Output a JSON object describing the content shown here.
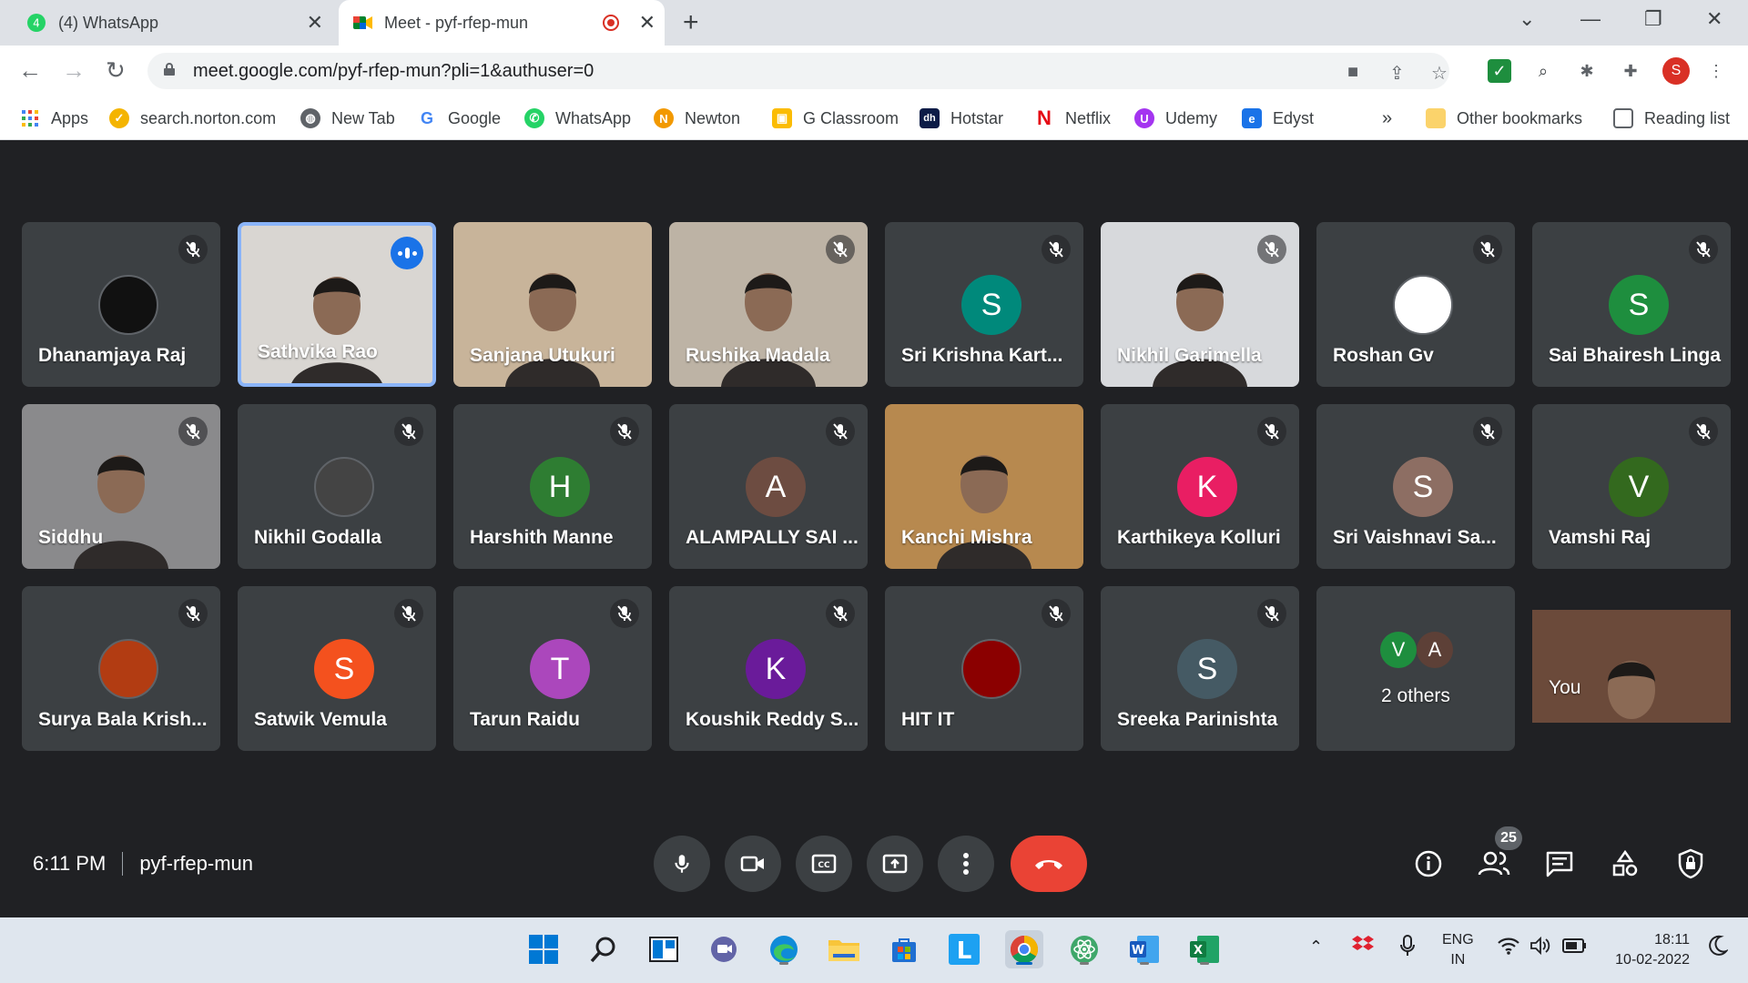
{
  "browser": {
    "tabs": [
      {
        "title": "(4) WhatsApp",
        "active": false
      },
      {
        "title": "Meet - pyf-rfep-mun",
        "active": true,
        "recording": true
      }
    ],
    "url": "meet.google.com/pyf-rfep-mun?pli=1&authuser=0",
    "profile_initial": "S",
    "bookmarks": [
      {
        "label": "Apps",
        "icon": "apps-grid-icon",
        "color": "#4285f4"
      },
      {
        "label": "search.norton.com",
        "icon": "norton-icon",
        "color": "#f4b400"
      },
      {
        "label": "New Tab",
        "icon": "globe-icon",
        "color": "#5f6368"
      },
      {
        "label": "Google",
        "icon": "google-icon",
        "color": "#4285f4"
      },
      {
        "label": "WhatsApp",
        "icon": "whatsapp-icon",
        "color": "#25d366"
      },
      {
        "label": "Newton",
        "icon": "newton-icon",
        "color": "#f29900"
      },
      {
        "label": "G Classroom",
        "icon": "classroom-icon",
        "color": "#fbbc04"
      },
      {
        "label": "Hotstar",
        "icon": "hotstar-icon",
        "color": "#0c1c47"
      },
      {
        "label": "Netflix",
        "icon": "netflix-icon",
        "color": "#e50914"
      },
      {
        "label": "Udemy",
        "icon": "udemy-icon",
        "color": "#a435f0"
      },
      {
        "label": "Edyst",
        "icon": "edyst-icon",
        "color": "#1a73e8"
      }
    ],
    "other_bookmarks": "Other bookmarks",
    "reading_list": "Reading list",
    "more_chevron": "»"
  },
  "meet": {
    "time": "6:11 PM",
    "code": "pyf-rfep-mun",
    "participant_count": "25",
    "tiles": [
      {
        "name": "Dhanamjaya Raj",
        "type": "image",
        "muted": true,
        "avatar_color": "#111111"
      },
      {
        "name": "Sathvika Rao",
        "type": "video",
        "muted": false,
        "speaking": true,
        "bg": "#d9d6d2"
      },
      {
        "name": "Sanjana Utukuri",
        "type": "video",
        "muted": false,
        "bg": "#c8b49a"
      },
      {
        "name": "Rushika Madala",
        "type": "video",
        "muted": true,
        "bg": "#bdb3a5"
      },
      {
        "name": "Sri Krishna Kart...",
        "type": "letter",
        "letter": "S",
        "muted": true,
        "avatar_color": "#00897b"
      },
      {
        "name": "Nikhil Garimella",
        "type": "video",
        "muted": true,
        "bg": "#d7d9dc"
      },
      {
        "name": "Roshan Gv",
        "type": "image",
        "muted": true,
        "avatar_color": "#ffffff"
      },
      {
        "name": "Sai Bhairesh Linga",
        "type": "letter",
        "letter": "S",
        "muted": true,
        "avatar_color": "#1e8e3e"
      },
      {
        "name": "Siddhu",
        "type": "video",
        "muted": true,
        "bg": "#8a8a8c"
      },
      {
        "name": "Nikhil Godalla",
        "type": "image",
        "muted": true,
        "avatar_color": "#444444"
      },
      {
        "name": "Harshith Manne",
        "type": "letter",
        "letter": "H",
        "muted": true,
        "avatar_color": "#2e7d32"
      },
      {
        "name": "ALAMPALLY SAI ...",
        "type": "letter",
        "letter": "A",
        "muted": true,
        "avatar_color": "#6d4c41"
      },
      {
        "name": "Kanchi Mishra",
        "type": "video",
        "muted": false,
        "bg": "#b7894f"
      },
      {
        "name": "Karthikeya Kolluri",
        "type": "letter",
        "letter": "K",
        "muted": true,
        "avatar_color": "#e91e63"
      },
      {
        "name": "Sri Vaishnavi Sa...",
        "type": "letter",
        "letter": "S",
        "muted": true,
        "avatar_color": "#8d6e63"
      },
      {
        "name": "Vamshi Raj",
        "type": "letter",
        "letter": "V",
        "muted": true,
        "avatar_color": "#33691e"
      },
      {
        "name": "Surya Bala Krish...",
        "type": "image",
        "muted": true,
        "avatar_color": "#b23c12"
      },
      {
        "name": "Satwik Vemula",
        "type": "letter",
        "letter": "S",
        "muted": true,
        "avatar_color": "#f4511e"
      },
      {
        "name": "Tarun Raidu",
        "type": "letter",
        "letter": "T",
        "muted": true,
        "avatar_color": "#ab47bc"
      },
      {
        "name": "Koushik Reddy S...",
        "type": "letter",
        "letter": "K",
        "muted": true,
        "avatar_color": "#6a1b9a"
      },
      {
        "name": "HIT IT",
        "type": "image",
        "muted": true,
        "avatar_color": "#8b0000"
      },
      {
        "name": "Sreeka Parinishta",
        "type": "letter",
        "letter": "S",
        "muted": true,
        "avatar_color": "#455a64"
      },
      {
        "name": "2 others",
        "type": "others",
        "letters": [
          "V",
          "A"
        ],
        "colors": [
          "#1e8e3e",
          "#5d4037"
        ]
      },
      {
        "name": "You",
        "type": "self",
        "bg": "#6b4a3a"
      }
    ]
  },
  "taskbar": {
    "lang_top": "ENG",
    "lang_bottom": "IN",
    "time": "18:11",
    "date": "10-02-2022"
  }
}
